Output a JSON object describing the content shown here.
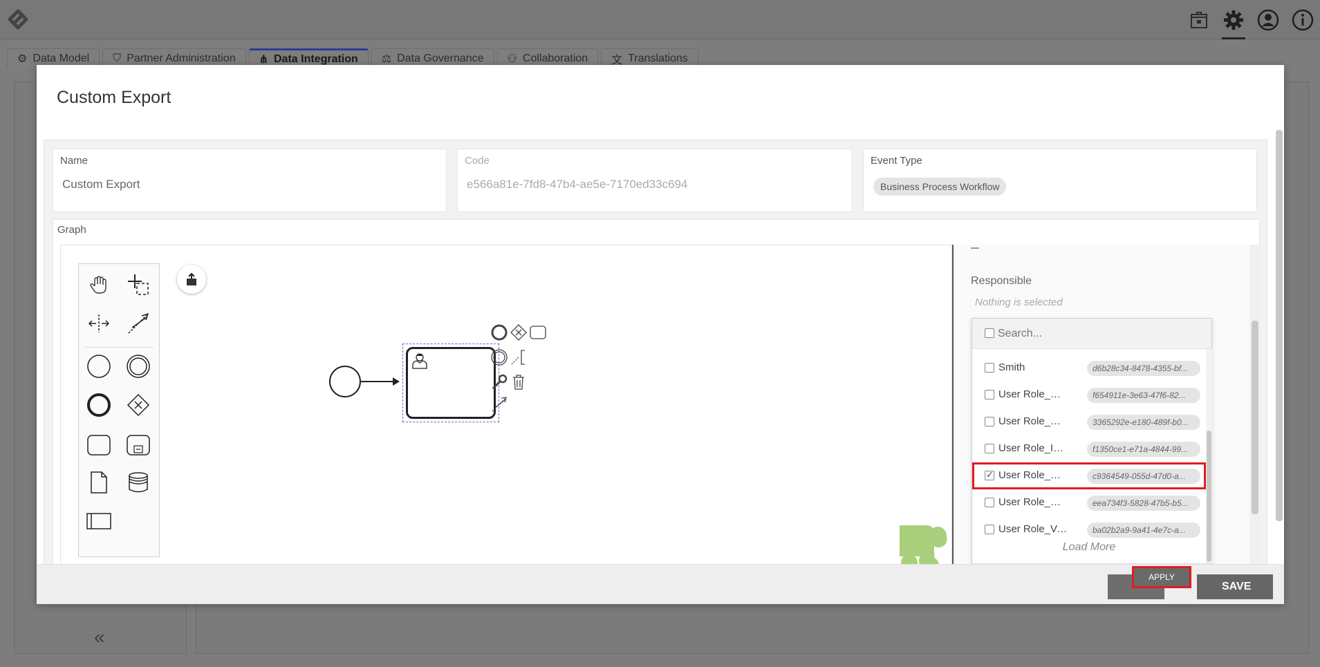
{
  "app": {
    "tabs": [
      {
        "label": "Data Model"
      },
      {
        "label": "Partner Administration"
      },
      {
        "label": "Data Integration"
      },
      {
        "label": "Data Governance"
      },
      {
        "label": "Collaboration"
      },
      {
        "label": "Translations"
      }
    ],
    "top_icons": [
      "package-icon",
      "gear-icon",
      "user-icon",
      "info-icon"
    ]
  },
  "modal": {
    "title": "Custom Export",
    "fields": {
      "name_label": "Name",
      "name_value": "Custom Export",
      "code_label": "Code",
      "code_value": "e566a81e-7fd8-47b4-ae5e-7170ed33c694",
      "event_type_label": "Event Type",
      "event_type_value": "Business Process Workflow"
    },
    "graph_label": "Graph",
    "properties": {
      "responsible_label": "Responsible",
      "nothing_selected": "Nothing is selected",
      "search_placeholder": "Search...",
      "items": [
        {
          "name": "Smith",
          "code": "d6b28c34-8478-4355-bf...",
          "checked": false
        },
        {
          "name": "User Role_Acco...",
          "code": "f654911e-3e63-47f6-82...",
          "checked": false
        },
        {
          "name": "User Role_Cons...",
          "code": "3365292e-e180-489f-b0...",
          "checked": false
        },
        {
          "name": "User Role_Infor...",
          "code": "f1350ce1-e71a-4844-99...",
          "checked": false
        },
        {
          "name": "User Role_Resp...",
          "code": "c9364549-055d-47d0-a...",
          "checked": true
        },
        {
          "name": "User Role_Sign...",
          "code": "eea734f3-5828-47b5-b5...",
          "checked": false
        },
        {
          "name": "User Role_Verifier",
          "code": "ba02b2a9-9a41-4e7c-a...",
          "checked": false
        }
      ],
      "load_more": "Load More",
      "apply_label": "APPLY"
    },
    "footer": {
      "save_label": "SAVE"
    }
  },
  "colors": {
    "highlight": "#e01b24",
    "active_tab": "#2a3d99",
    "bpmn_logo": "#8bc34a"
  }
}
